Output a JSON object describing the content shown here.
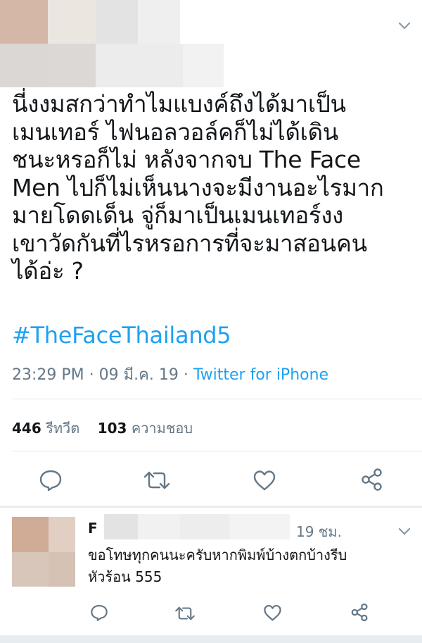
{
  "tweet": {
    "text": "นี่งงมสกว่าทำไมแบงค์ถึงได้มาเป็น\nเมนเทอร์ ไฟนอลวอล์คก็ไม่ได้เดิน\nชนะหรอก็ไม่ หลังจากจบ The Face\nMen ไปก็ไม่เห็นนางจะมีงานอะไรมาก\nมายโดดเด็น จู่ก็มาเป็นเมนเทอร์งง\nเขาวัดกันที่ไรหรอการที่จะมาสอนคน\nได้อ่ะ ?",
    "hashtag": "#TheFaceThailand5",
    "time": "23:29 PM",
    "date": "09 มี.ค. 19",
    "source": "Twitter for iPhone",
    "retweet_count": "446",
    "retweet_label": "รีทวีต",
    "like_count": "103",
    "like_label": "ความชอบ"
  },
  "reply": {
    "author_initial": "F",
    "time": "19 ชม.",
    "text": "ขอโทษทุกคนนะครับหากพิมพ์บ้างตกบ้างรีบ\nหัวร้อน 555"
  },
  "separator": "·",
  "colors": {
    "accent": "#1da1f2",
    "muted": "#657786",
    "text": "#14171a",
    "divider": "#e1e8ed"
  },
  "icons": [
    "chevron-down-icon",
    "reply-icon",
    "retweet-icon",
    "like-icon",
    "share-icon"
  ]
}
